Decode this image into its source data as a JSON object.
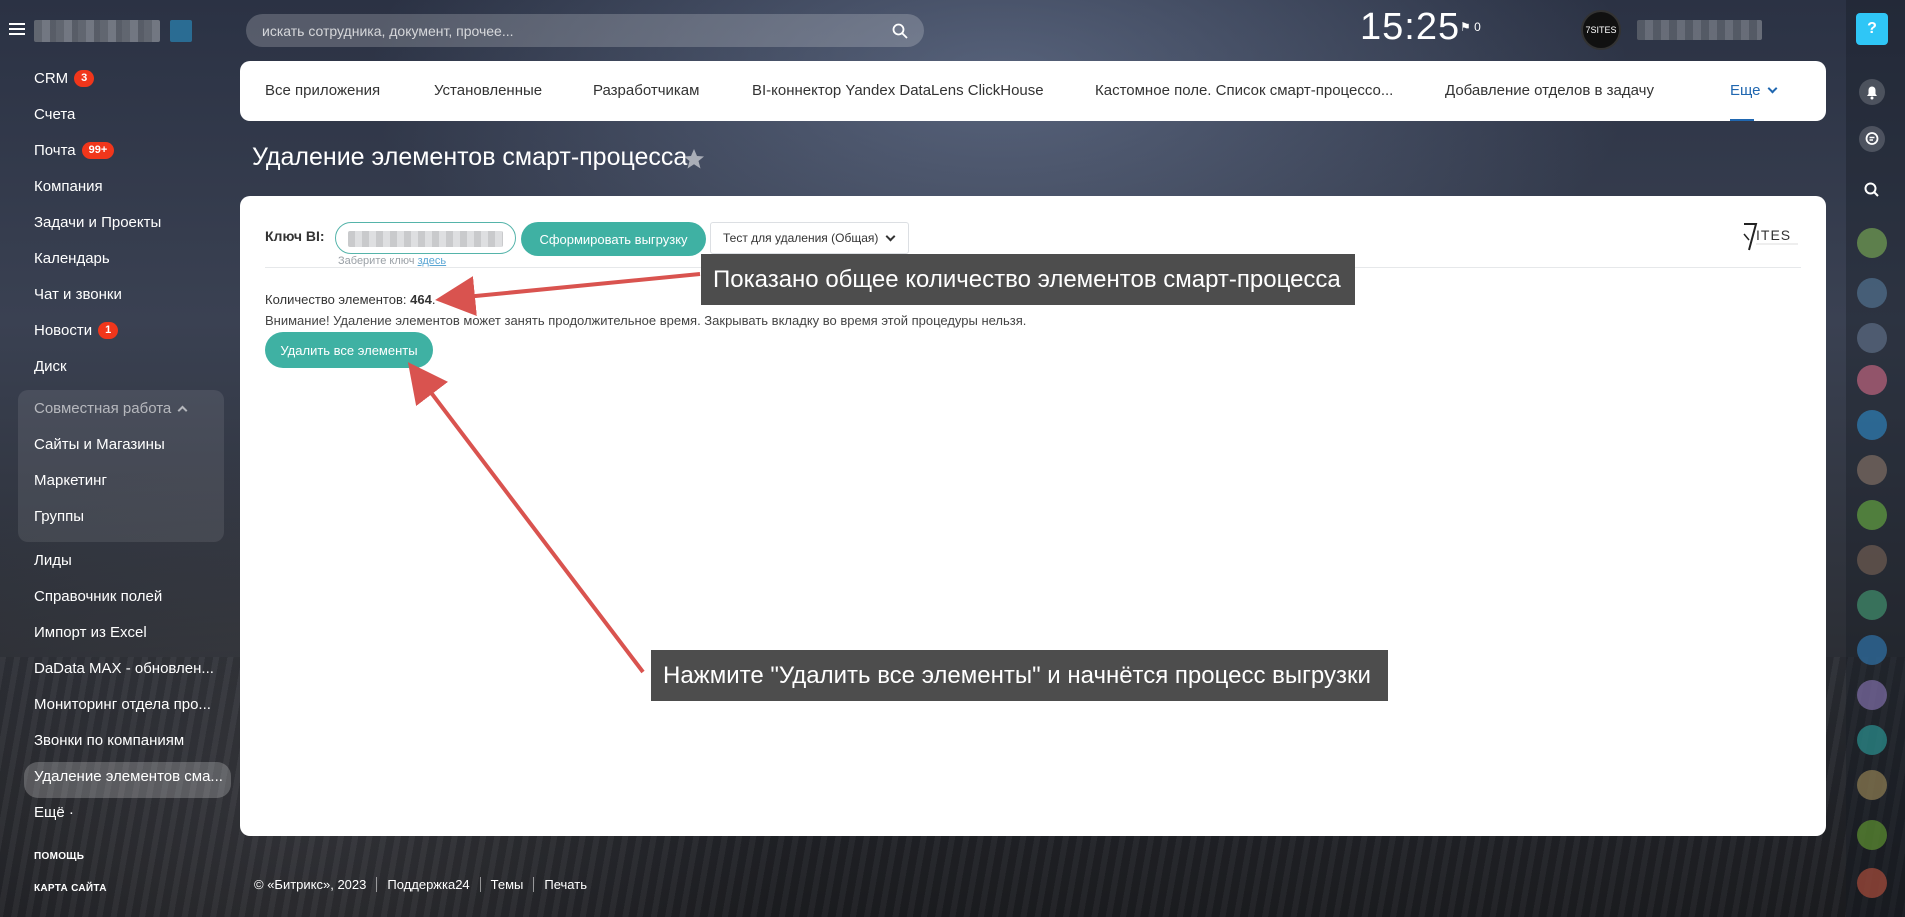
{
  "search": {
    "placeholder": "искать сотрудника, документ, прочее..."
  },
  "header": {
    "clock": "15:25",
    "flag_count": "0"
  },
  "sidebar": {
    "items": [
      {
        "label": "CRM",
        "badge": "3"
      },
      {
        "label": "Счета"
      },
      {
        "label": "Почта",
        "badge": "99+"
      },
      {
        "label": "Компания"
      },
      {
        "label": "Задачи и Проекты"
      },
      {
        "label": "Календарь"
      },
      {
        "label": "Чат и звонки"
      },
      {
        "label": "Новости",
        "badge": "1"
      },
      {
        "label": "Диск"
      }
    ],
    "group": {
      "title": "Совместная работа",
      "items": [
        {
          "label": "Сайты и Магазины"
        },
        {
          "label": "Маркетинг"
        },
        {
          "label": "Группы"
        }
      ]
    },
    "items2": [
      {
        "label": "Лиды"
      },
      {
        "label": "Справочник полей"
      },
      {
        "label": "Импорт из Excel"
      },
      {
        "label": "DaData MAX - обновлен..."
      },
      {
        "label": "Мониторинг отдела про..."
      },
      {
        "label": "Звонки по компаниям"
      },
      {
        "label": "Удаление элементов сма..."
      },
      {
        "label": "Ещё ·"
      }
    ],
    "help": "ПОМОЩЬ",
    "sitemap": "КАРТА САЙТА"
  },
  "tabs": [
    "Все приложения",
    "Установленные",
    "Разработчикам",
    "BI-коннектор Yandex DataLens ClickHouse",
    "Кастомное поле. Список смарт-процессо...",
    "Добавление отделов в задачу",
    "Еще"
  ],
  "page": {
    "title": "Удаление элементов смарт-процесса",
    "bi_label": "Ключ BI:",
    "key_hint_text": "Заберите ключ ",
    "key_hint_link": "здесь",
    "export_button": "Сформировать выгрузку",
    "select_value": "Тест для удаления (Общая)",
    "count_label": "Количество элементов: ",
    "count_value": "464",
    "count_suffix": ".",
    "warning": "Внимание! Удаление элементов может занять продолжительное время. Закрывать вкладку во время этой процедуры нельзя.",
    "delete_button": "Удалить все элементы"
  },
  "annotations": {
    "callout_1": "Показано общее количество элементов смарт-процесса",
    "callout_2": "Нажмите \"Удалить все элементы\" и начнётся процесс выгрузки"
  },
  "footer": {
    "copyright": "© «Битрикс», 2023",
    "support": "Поддержка24",
    "themes": "Темы",
    "print": "Печать"
  },
  "colors": {
    "accent": "#3fb1a3",
    "link": "#2067b0",
    "badge": "#f1361b",
    "help": "#2fc6f6",
    "arrow": "#d9534f"
  }
}
